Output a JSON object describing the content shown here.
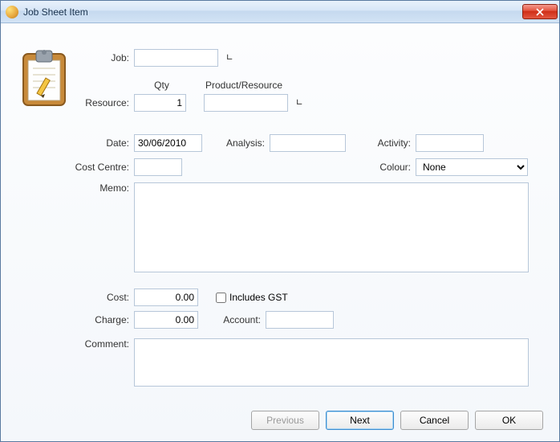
{
  "window": {
    "title": "Job Sheet Item"
  },
  "labels": {
    "job": "Job:",
    "qty_header": "Qty",
    "product_header": "Product/Resource",
    "resource": "Resource:",
    "date": "Date:",
    "analysis": "Analysis:",
    "activity": "Activity:",
    "cost_centre": "Cost Centre:",
    "colour": "Colour:",
    "memo": "Memo:",
    "cost": "Cost:",
    "includes_gst": "Includes GST",
    "charge": "Charge:",
    "account": "Account:",
    "comment": "Comment:"
  },
  "values": {
    "job": "",
    "qty": "1",
    "product": "",
    "date": "30/06/2010",
    "analysis": "",
    "activity": "",
    "cost_centre": "",
    "colour": "None",
    "memo": "",
    "cost": "0.00",
    "includes_gst": false,
    "charge": "0.00",
    "account": "",
    "comment": ""
  },
  "buttons": {
    "previous": "Previous",
    "next": "Next",
    "cancel": "Cancel",
    "ok": "OK"
  }
}
